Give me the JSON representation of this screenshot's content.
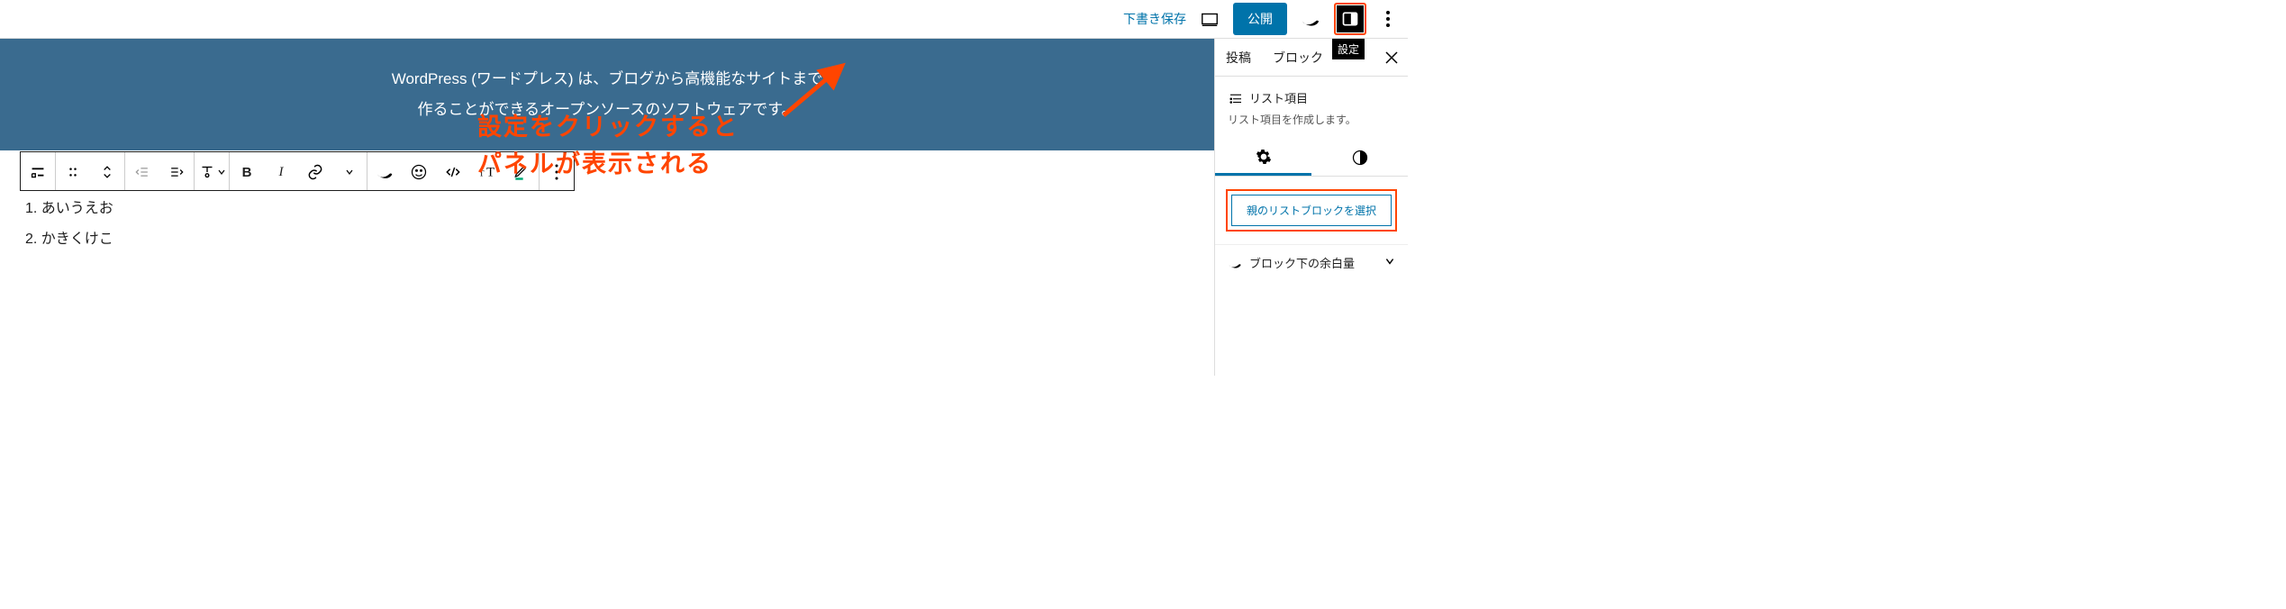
{
  "header": {
    "save_draft": "下書き保存",
    "publish": "公開",
    "settings_tooltip": "設定"
  },
  "cover": {
    "line1": "WordPress (ワードプレス) は、ブログから高機能なサイトまで",
    "line2": "作ることができるオープンソースのソフトウェアです。"
  },
  "list": {
    "items": [
      "あいうえお",
      "かきくけこ"
    ]
  },
  "sidebar": {
    "tab_post": "投稿",
    "tab_block": "ブロック",
    "block_name": "リスト項目",
    "block_desc": "リスト項目を作成します。",
    "parent_select": "親のリストブロックを選択",
    "margin_title": "ブロック下の余白量"
  },
  "annotation": {
    "line1": "設定をクリックすると",
    "line2": "パネルが表示される"
  },
  "toolbar": {
    "bold": "B",
    "italic": "I"
  },
  "colors": {
    "accent": "#0073aa",
    "highlight": "#ff4500",
    "cover_bg": "#3a6b8f"
  }
}
